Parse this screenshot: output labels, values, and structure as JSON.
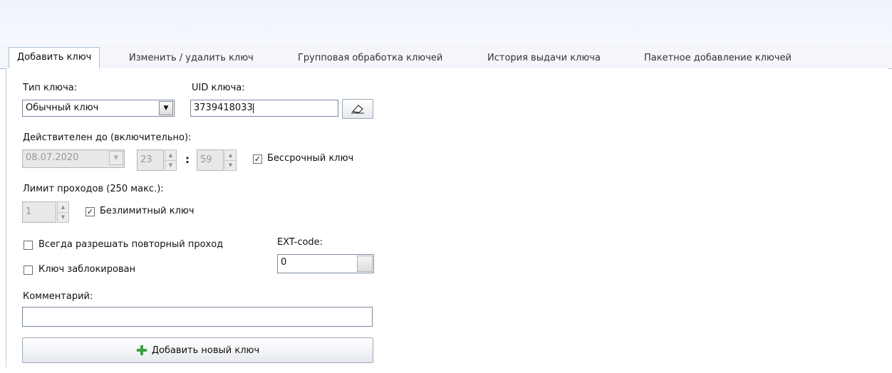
{
  "tabs": [
    {
      "label": "Добавить ключ",
      "active": true
    },
    {
      "label": "Изменить / удалить ключ",
      "active": false
    },
    {
      "label": "Групповая обработка ключей",
      "active": false
    },
    {
      "label": "История выдачи ключа",
      "active": false
    },
    {
      "label": "Пакетное добавление ключей",
      "active": false
    }
  ],
  "form": {
    "key_type_label": "Тип ключа:",
    "key_type_value": "Обычный ключ",
    "uid_label": "UID ключа:",
    "uid_value": "3739418033",
    "valid_until_label": "Действителен до (включительно):",
    "date_value": "08.07.2020",
    "hour_value": "23",
    "time_separator": ":",
    "minute_value": "59",
    "perpetual_label": "Бессрочный ключ",
    "perpetual_checked": true,
    "pass_limit_label": "Лимит проходов (250 макс.):",
    "pass_limit_value": "1",
    "unlimited_label": "Безлимитный ключ",
    "unlimited_checked": true,
    "allow_repeat_label": "Всегда разрешать повторный проход",
    "allow_repeat_checked": false,
    "blocked_label": "Ключ заблокирован",
    "blocked_checked": false,
    "ext_code_label": "EXT-code:",
    "ext_code_value": "0",
    "comment_label": "Комментарий:",
    "comment_value": "",
    "add_button_label": "Добавить новый ключ"
  },
  "icons": {
    "eraser": "eraser-icon",
    "add": "plus-icon"
  },
  "colors": {
    "tab_border": "#aebfd8",
    "plus_green": "#3aa13a"
  }
}
